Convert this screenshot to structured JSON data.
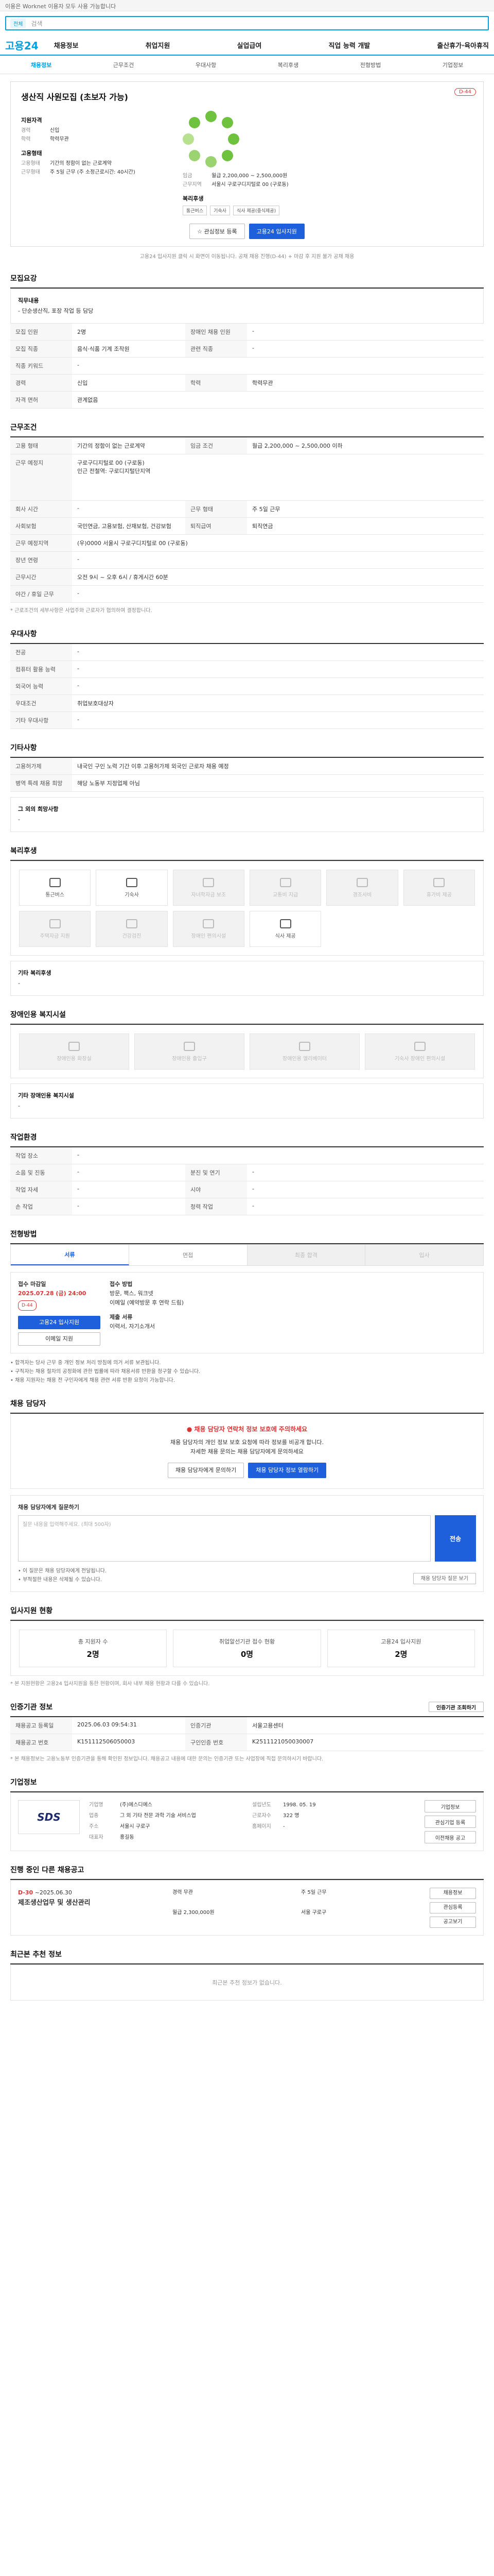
{
  "topbar": {
    "notice": "이용은 Worknet 이용자 모두 사용 가능합니다"
  },
  "search": {
    "category": "전체",
    "placeholder": "검색"
  },
  "gnb": {
    "logo": "고용24",
    "menu": [
      "채용정보",
      "취업지원",
      "실업급여",
      "직업 능력 개발",
      "출산휴가·육아휴직"
    ]
  },
  "tabs": [
    "채용정보",
    "근무조건",
    "우대사항",
    "복리후생",
    "전형방법",
    "기업정보"
  ],
  "header": {
    "title": "생산직 사원모집 (초보자 가능)",
    "badge": "D-44",
    "recruit_title": "지원자격",
    "career_k": "경력",
    "career_v": "신입",
    "edu_k": "학력",
    "edu_v": "학력무관",
    "cond_title": "고용형태",
    "type_k": "고용형태",
    "type_v": "기간의 정함이 없는 근로계약",
    "worktime_k": "근무형태",
    "worktime_v": "주 5일 근무 (주 소정근로시간: 40시간)",
    "pay_k": "임금",
    "pay_v": "월급 2,200,000 ~ 2,500,000원",
    "loc_k": "근무지역",
    "loc_v": "서울시 구로구디지털로 00 (구로동)",
    "welfare_title": "복리후생",
    "tags": [
      "통근버스",
      "기숙사",
      "식사 제공(중식제공)"
    ]
  },
  "buttons": {
    "interest": "☆ 관심정보 등록",
    "apply": "고용24 입사지원"
  },
  "header_note": "고용24 입사지원 클릭 시 화면이 이동됩니다. 공채 채용 진행(D-44) + 마감 후 지원 불가 공채 채용",
  "sections": {
    "recruit": "모집요강",
    "conditions": "근무조건",
    "prefer": "우대사항",
    "other": "기타사항",
    "welfare": "복리후생",
    "disabled": "장애인용 복지시설",
    "workplace": "작업환경",
    "process": "전형방법",
    "contact": "채용 담당자",
    "status": "입사지원 현황",
    "manager": "인증기관 정보",
    "company": "기업정보",
    "related": "진행 중인 다른 채용공고",
    "recent": "최근본 추천 정보"
  },
  "recruit": {
    "sub": "직무내용",
    "desc": "- 단순생산직, 포장 작업 등 담당",
    "rows": [
      {
        "k": "모집 인원",
        "v": "2명",
        "k2": "장애인 채용 인원",
        "v2": "-"
      },
      {
        "k": "모집 직종",
        "v": "음식·식품 기계 조작원",
        "k2": "관련 직종",
        "v2": "-"
      },
      {
        "k": "직종 키워드",
        "v": "-",
        "k2": "",
        "v2": ""
      },
      {
        "k": "경력",
        "v": "신입",
        "k2": "학력",
        "v2": "학력무관"
      },
      {
        "k": "자격 면허",
        "v": "관계없음",
        "k2": "",
        "v2": ""
      }
    ]
  },
  "conditions": {
    "rows": [
      {
        "k": "고용 형태",
        "v": "기간의 정함이 없는 근로계약",
        "k2": "임금 조건",
        "v2": "월급 2,200,000 ~ 2,500,000 이하"
      },
      {
        "k": "근무 예정지",
        "v": "구로구디지털로 00 (구로동)\n인근 전철역: 구로디지털단지역",
        "k2": "",
        "v2": ""
      },
      {
        "k": "회사 시간",
        "v": "-",
        "k2": "근무 형태",
        "v2": "주 5일 근무"
      },
      {
        "k": "사회보험",
        "v": "국민연금, 고용보험, 산재보험, 건강보험",
        "k2": "퇴직급여",
        "v2": "퇴직연금"
      },
      {
        "k": "근무 예정지역",
        "v": "(우)0000 서울시 구로구디지털로 00 (구로동)",
        "k2": "",
        "v2": ""
      },
      {
        "k": "장년 연령",
        "v": "-",
        "k2": "",
        "v2": ""
      },
      {
        "k": "근무시간",
        "v": "오전 9시 ~ 오후 6시 / 휴게시간 60분",
        "k2": "",
        "v2": ""
      },
      {
        "k": "야간 / 휴일 근무",
        "v": "-",
        "k2": "",
        "v2": ""
      }
    ],
    "note": "* 근로조건의 세부사항은 사업주와 근로자가 협의하여 결정합니다."
  },
  "prefer": {
    "rows": [
      {
        "k": "전공",
        "v": "-"
      },
      {
        "k": "컴퓨터 활용 능력",
        "v": "-"
      },
      {
        "k": "외국어 능력",
        "v": "-"
      },
      {
        "k": "우대조건",
        "v": "취업보호대상자"
      },
      {
        "k": "기타 우대사항",
        "v": "-"
      }
    ]
  },
  "other": {
    "rows": [
      {
        "k": "고용허가제",
        "v": "내국인 구인 노력 기간 이후 고용허가제 외국인 근로자 채용 예정"
      },
      {
        "k": "병역 특례 채용 희망",
        "v": "해당 노동부 지정업체 아님"
      }
    ],
    "extra_title": "그 외의 희망사항",
    "extra_v": "-"
  },
  "welfare": {
    "items": [
      {
        "name": "통근버스",
        "on": true
      },
      {
        "name": "기숙사",
        "on": true
      },
      {
        "name": "자녀학자금 보조",
        "on": false
      },
      {
        "name": "교통비 지급",
        "on": false
      },
      {
        "name": "경조사비",
        "on": false
      },
      {
        "name": "휴가비 제공",
        "on": false
      },
      {
        "name": "주택자금 지원",
        "on": false
      },
      {
        "name": "건강검진",
        "on": false
      },
      {
        "name": "장애인 편의시설",
        "on": false
      },
      {
        "name": "식사 제공",
        "on": true
      }
    ],
    "other_title": "기타 복리후생",
    "other_v": "-"
  },
  "disabled": {
    "items": [
      "장애인용 화장실",
      "장애인용 출입구",
      "장애인용 엘리베이터",
      "기숙사 장애인 편의시설"
    ],
    "other_title": "기타 장애인용 복지시설",
    "other_v": "-"
  },
  "workplace": {
    "rows": [
      {
        "k": "작업 장소",
        "v": "-",
        "k2": "",
        "v2": ""
      },
      {
        "k": "소음 및 진동",
        "v": "-",
        "k2": "분진 및 연기",
        "v2": "-"
      },
      {
        "k": "작업 자세",
        "v": "-",
        "k2": "시야",
        "v2": "-"
      },
      {
        "k": "손 작업",
        "v": "-",
        "k2": "청력 작업",
        "v2": "-"
      }
    ]
  },
  "process": {
    "steps": [
      "서류",
      "면접",
      "최종 합격",
      "입사"
    ],
    "deadline_title": "접수 마감일",
    "deadline": "2025.07.28 (금) 24:00",
    "dday": "D-44",
    "apply_btn": "고용24 입사지원",
    "mail_btn": "이메일 지원",
    "method_title": "접수 방법",
    "method": "방문, 팩스, 워크넷\n이메일 (예약방문 후 연락 드림)",
    "docs_title": "제출 서류",
    "docs": "이력서, 자기소개서",
    "bullets": [
      "• 합격자는 당사 근무 중 개인 정보 처리 방침에 의거 서류 보관됩니다.",
      "• 구직자는 채용 절차의 공정화에 관한 법률에 따라 채용서류 반환을 청구할 수 있습니다.",
      "• 채용 지원자는 채용 전 구인자에게 채용 관련 서류 반환 요청이 가능합니다."
    ]
  },
  "contact": {
    "warn": "채용 담당자 연락처 정보 보호에 주의하세요",
    "line1": "채용 담당자의 개인 정보 보호 요청에 따라 정보를 비공개 합니다.",
    "line2": "자세한 채용 문의는 채용 담당자에게 문의하세요",
    "btn1": "채용 담당자에게 문의하기",
    "btn2": "채용 담당자 정보 열람하기",
    "inq_title": "채용 담당자에게 질문하기",
    "inq_placeholder": "질문 내용을 입력해주세요. (최대 500자)",
    "send": "전송",
    "inq_notes": [
      "• 이 질문은 채용 담당자에게 전달됩니다.",
      "• 부적절한 내용은 삭제될 수 있습니다."
    ],
    "more_btn": "채용 담당자 질문 보기"
  },
  "status": {
    "items": [
      {
        "k": "총 지원자 수",
        "v": "2명"
      },
      {
        "k": "취업알선기관 접수 현황",
        "v": "0명"
      },
      {
        "k": "고용24 입사지원",
        "v": "2명"
      }
    ],
    "note": "* 본 지원현황은 고용24 입사지원을 통한 현황이며, 회사 내부 채용 현황과 다를 수 있습니다."
  },
  "manager": {
    "right": "인증기관 조회하기",
    "rows": [
      {
        "k": "채용공고 등록일",
        "v": "2025.06.03 09:54:31",
        "k2": "인증기관",
        "v2": "서울고용센터"
      },
      {
        "k": "채용공고 번호",
        "v": "K151112506050003",
        "k2": "구인인증 번호",
        "v2": "K2511121050030007"
      }
    ],
    "note": "* 본 채용정보는 고용노동부 인증기관을 통해 확인된 정보입니다. 채용공고 내용에 대한 문의는 인증기관 또는 사업장에 직접 문의하시기 바랍니다."
  },
  "company": {
    "logo": "SDS",
    "name_k": "기업명",
    "name_v": "(주)에스디에스",
    "size_k": "설립년도",
    "size_v": "1998. 05. 19",
    "ind_k": "업종",
    "ind_v": "그 외 기타 전문 과학 기술 서비스업",
    "emp_k": "근로자수",
    "emp_v": "322 명",
    "addr_k": "주소",
    "addr_v": "서울시 구로구",
    "url_k": "홈페이지",
    "url_v": "-",
    "boss_k": "대표자",
    "boss_v": "홍길동",
    "side": [
      "기업정보",
      "관심기업 등록",
      "이전채용 공고"
    ]
  },
  "related": {
    "dday": "D-30",
    "date": "~2025.06.30",
    "title": "제조생산업무 및 생산관리",
    "info": [
      "경력 무관",
      "주 5일 근무",
      "월급 2,300,000원",
      "서울 구로구"
    ],
    "side": [
      "채용정보",
      "관심등록",
      "공고보기"
    ]
  },
  "recent": {
    "empty": "최근본 추천 정보가 없습니다."
  }
}
